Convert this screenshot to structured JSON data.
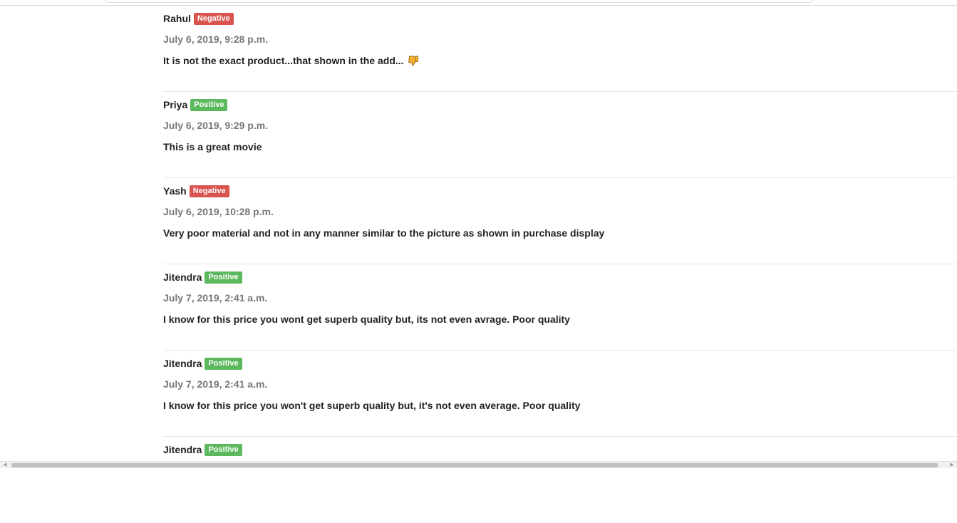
{
  "reviews": [
    {
      "name": "Rahul",
      "sentiment": "Negative",
      "date": "July 6, 2019, 9:28 p.m.",
      "text": "It is not the exact product...that shown in the add...",
      "emoji": "thumbs-down-icon"
    },
    {
      "name": "Priya",
      "sentiment": "Positive",
      "date": "July 6, 2019, 9:29 p.m.",
      "text": "This is a great movie"
    },
    {
      "name": "Yash",
      "sentiment": "Negative",
      "date": "July 6, 2019, 10:28 p.m.",
      "text": "Very poor material and not in any manner similar to the picture as shown in purchase display"
    },
    {
      "name": "Jitendra",
      "sentiment": "Positive",
      "date": "July 7, 2019, 2:41 a.m.",
      "text": "I know for this price you wont get superb quality but, its not even avrage. Poor quality"
    },
    {
      "name": "Jitendra",
      "sentiment": "Positive",
      "date": "July 7, 2019, 2:41 a.m.",
      "text": "I know for this price you won't get superb quality but, it's not even average. Poor quality"
    },
    {
      "name": "Jitendra",
      "sentiment": "Positive",
      "date": "",
      "text": ""
    }
  ],
  "colors": {
    "negative": "#d9534f",
    "positive": "#5cb85c",
    "date": "#777777",
    "text": "#222222"
  },
  "scrollbar": {
    "left_arrow": "◀",
    "right_arrow": "▶"
  }
}
